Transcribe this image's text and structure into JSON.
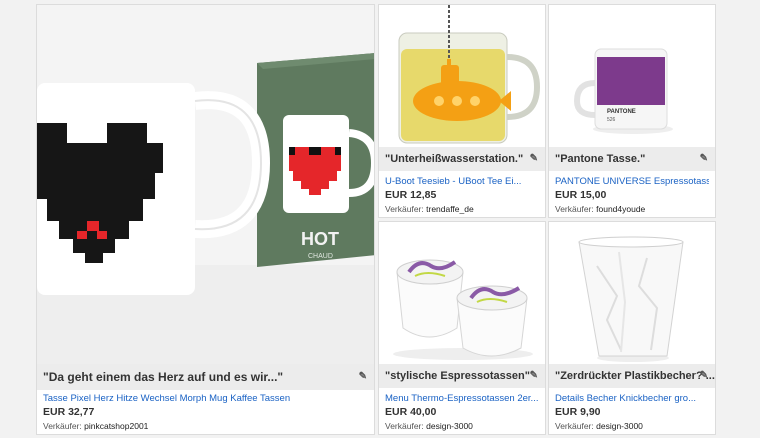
{
  "items": [
    {
      "caption": "\"Da geht einem das Herz auf und es wir...\"",
      "title": "Tasse Pixel Herz Hitze Wechsel Morph Mug Kaffee Tassen",
      "price": "EUR 32,77",
      "seller_label": "Verkäufer:",
      "seller": "pinkcatshop2001",
      "box_text": "HOT",
      "box_subtext": "CHAUD"
    },
    {
      "caption": "\"Unterheißwasserstation.\"",
      "title": "U-Boot Teesieb - UBoot Tee Ei...",
      "price": "EUR 12,85",
      "seller_label": "Verkäufer:",
      "seller": "trendaffe_de"
    },
    {
      "caption": "\"Pantone Tasse.\"",
      "title": "PANTONE UNIVERSE Espressotasse...",
      "price": "EUR 15,00",
      "seller_label": "Verkäufer:",
      "seller": "found4youde",
      "mug_text": "PANTONE",
      "mug_subtext": "526"
    },
    {
      "caption": "\"stylische Espressotassen\"",
      "title": "Menu Thermo-Espressotassen 2er...",
      "price": "EUR 40,00",
      "seller_label": "Verkäufer:",
      "seller": "design-3000"
    },
    {
      "caption": "\"Zerdrückter Plastikbecher? ...\"",
      "title": "Details Becher Knickbecher gro...",
      "price": "EUR 9,90",
      "seller_label": "Verkäufer:",
      "seller": "design-3000"
    }
  ],
  "icons": {
    "edit": "pencil-icon"
  },
  "colors": {
    "link": "#1a62c4",
    "caption_bg": "#ececec",
    "heart": "#e5262a",
    "pantone_purple": "#7d3a8c",
    "box_green": "#5f7a5f"
  }
}
